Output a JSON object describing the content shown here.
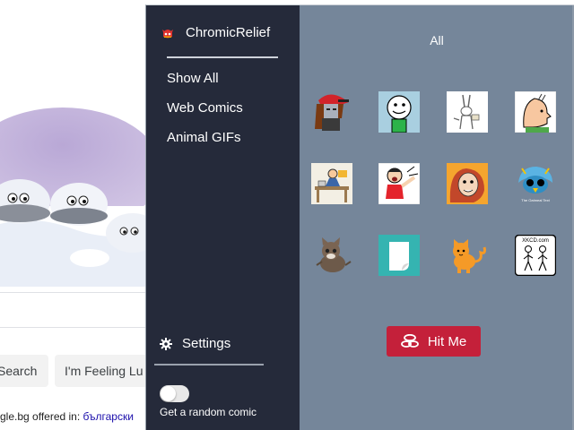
{
  "background_page": {
    "search_button_label": "Search",
    "lucky_button_label": "I'm Feeling Lu",
    "offered_in_text": "gle.bg offered in:",
    "offered_language": "български"
  },
  "sidebar": {
    "brand_name": "ChromicRelief",
    "nav_items": [
      {
        "label": "Show All"
      },
      {
        "label": "Web Comics"
      },
      {
        "label": "Animal GIFs"
      }
    ],
    "settings_label": "Settings",
    "random_toggle": {
      "label": "Get a random comic",
      "enabled": false
    }
  },
  "main": {
    "title": "All",
    "comics": [
      {
        "icon": "red-hat-character-icon"
      },
      {
        "icon": "cyanide-happiness-icon"
      },
      {
        "icon": "bunny-sketch-icon"
      },
      {
        "icon": "bald-man-profile-icon"
      },
      {
        "icon": "desk-scene-icon"
      },
      {
        "icon": "shouting-man-icon"
      },
      {
        "icon": "red-hair-girl-icon"
      },
      {
        "icon": "oatmeal-bird-icon",
        "caption": "The Oatmeal Text"
      },
      {
        "icon": "kitten-icon"
      },
      {
        "icon": "teal-page-icon"
      },
      {
        "icon": "orange-cat-icon"
      },
      {
        "icon": "xkcd-icon",
        "caption": "XKCD.com"
      }
    ],
    "hit_me_label": "Hit Me"
  },
  "colors": {
    "sidebar_bg": "#252a3a",
    "main_bg": "#75869a",
    "accent_button": "#c4203a"
  }
}
